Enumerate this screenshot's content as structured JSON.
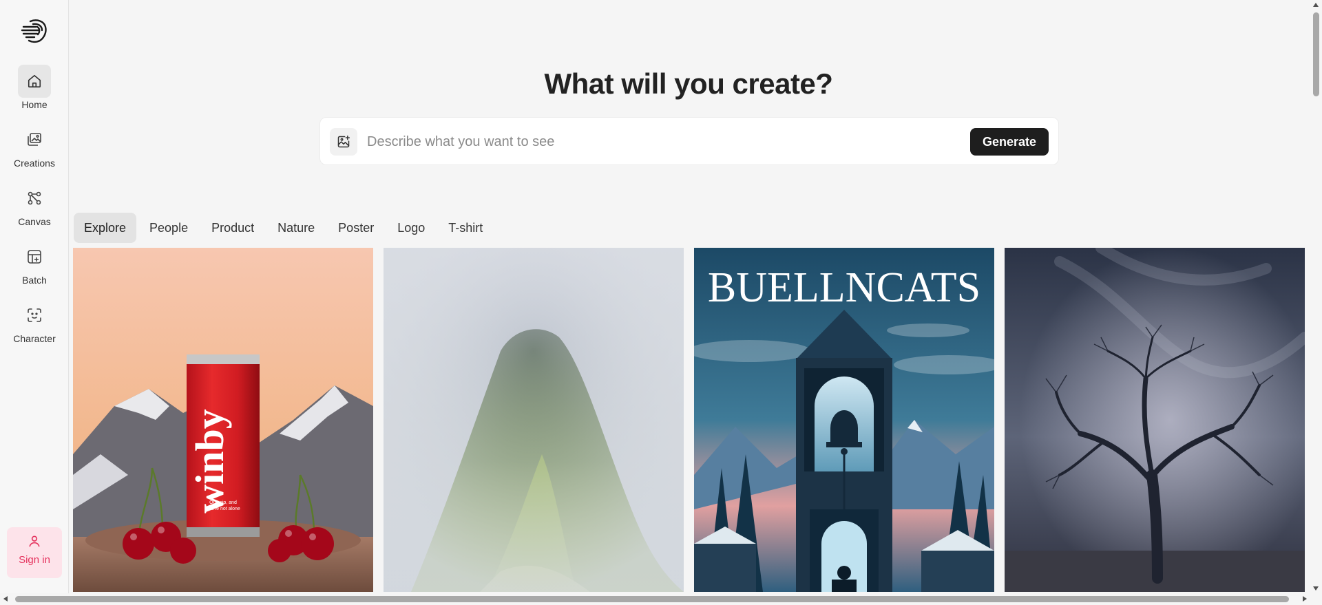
{
  "sidebar": {
    "logo_icon": "brain-lines-icon",
    "items": [
      {
        "label": "Home",
        "icon": "home-icon",
        "active": true
      },
      {
        "label": "Creations",
        "icon": "images-icon",
        "active": false
      },
      {
        "label": "Canvas",
        "icon": "canvas-icon",
        "active": false
      },
      {
        "label": "Batch",
        "icon": "batch-icon",
        "active": false
      },
      {
        "label": "Character",
        "icon": "face-scan-icon",
        "active": false
      }
    ],
    "signin": {
      "label": "Sign in",
      "icon": "user-icon",
      "color": "#e5335e"
    }
  },
  "hero": {
    "title": "What will you create?"
  },
  "prompt": {
    "placeholder": "Describe what you want to see",
    "value": "",
    "upload_icon": "image-add-icon",
    "generate_label": "Generate"
  },
  "tabs": [
    "Explore",
    "People",
    "Product",
    "Nature",
    "Poster",
    "Logo",
    "T-shirt"
  ],
  "active_tab": "Explore",
  "gallery": [
    {
      "subject": "red-soda-can-with-cherries",
      "can_brand": "winby",
      "can_tagline": "One sip, and you're not alone"
    },
    {
      "subject": "misty-green-mountain"
    },
    {
      "subject": "bell-tower-poster",
      "poster_title": "BUELLNCATS"
    },
    {
      "subject": "bare-tree-in-fog"
    }
  ],
  "colors": {
    "accent": "#1e1e1e",
    "signin_bg": "#fde3ea",
    "signin_text": "#e5335e"
  }
}
